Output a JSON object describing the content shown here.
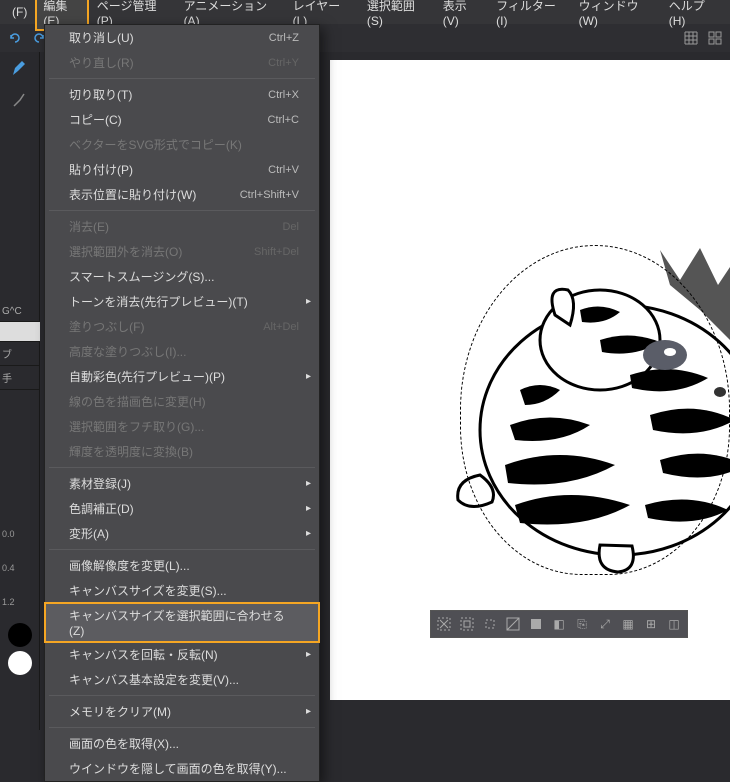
{
  "menubar": [
    {
      "label": "(F)"
    },
    {
      "label": "編集(E)",
      "highlighted": true
    },
    {
      "label": "ページ管理(P)"
    },
    {
      "label": "アニメーション(A)"
    },
    {
      "label": "レイヤー(L)"
    },
    {
      "label": "選択範囲(S)"
    },
    {
      "label": "表示(V)"
    },
    {
      "label": "フィルター(I)"
    },
    {
      "label": "ウィンドウ(W)"
    },
    {
      "label": "ヘルプ(H)"
    }
  ],
  "menu": {
    "items": [
      {
        "label": "取り消し(U)",
        "shortcut": "Ctrl+Z"
      },
      {
        "label": "やり直し(R)",
        "shortcut": "Ctrl+Y",
        "disabled": true
      },
      {
        "sep": true
      },
      {
        "label": "切り取り(T)",
        "shortcut": "Ctrl+X"
      },
      {
        "label": "コピー(C)",
        "shortcut": "Ctrl+C"
      },
      {
        "label": "ベクターをSVG形式でコピー(K)",
        "disabled": true
      },
      {
        "label": "貼り付け(P)",
        "shortcut": "Ctrl+V"
      },
      {
        "label": "表示位置に貼り付け(W)",
        "shortcut": "Ctrl+Shift+V"
      },
      {
        "sep": true
      },
      {
        "label": "消去(E)",
        "shortcut": "Del",
        "disabled": true
      },
      {
        "label": "選択範囲外を消去(O)",
        "shortcut": "Shift+Del",
        "disabled": true
      },
      {
        "label": "スマートスムージング(S)..."
      },
      {
        "label": "トーンを消去(先行プレビュー)(T)",
        "sub": true
      },
      {
        "label": "塗りつぶし(F)",
        "shortcut": "Alt+Del",
        "disabled": true
      },
      {
        "label": "高度な塗りつぶし(I)...",
        "disabled": true
      },
      {
        "label": "自動彩色(先行プレビュー)(P)",
        "sub": true
      },
      {
        "label": "線の色を描画色に変更(H)",
        "disabled": true
      },
      {
        "label": "選択範囲をフチ取り(G)...",
        "disabled": true
      },
      {
        "label": "輝度を透明度に変換(B)",
        "disabled": true
      },
      {
        "sep": true
      },
      {
        "label": "素材登録(J)",
        "sub": true
      },
      {
        "label": "色調補正(D)",
        "sub": true
      },
      {
        "label": "変形(A)",
        "sub": true
      },
      {
        "sep": true
      },
      {
        "label": "画像解像度を変更(L)..."
      },
      {
        "label": "キャンバスサイズを変更(S)..."
      },
      {
        "label": "キャンバスサイズを選択範囲に合わせる(Z)",
        "highlighted": true
      },
      {
        "label": "キャンバスを回転・反転(N)",
        "sub": true
      },
      {
        "label": "キャンバス基本設定を変更(V)..."
      },
      {
        "sep": true
      },
      {
        "label": "メモリをクリア(M)",
        "sub": true
      },
      {
        "sep": true
      },
      {
        "label": "画面の色を取得(X)..."
      },
      {
        "label": "ウインドウを隠して画面の色を取得(Y)..."
      }
    ]
  },
  "side": {
    "gc_label": "G^C",
    "brush_label": "ブ",
    "hand_label": "手"
  },
  "ruler": {
    "v1": "0.0",
    "v2": "0.4",
    "v3": "1.2"
  }
}
